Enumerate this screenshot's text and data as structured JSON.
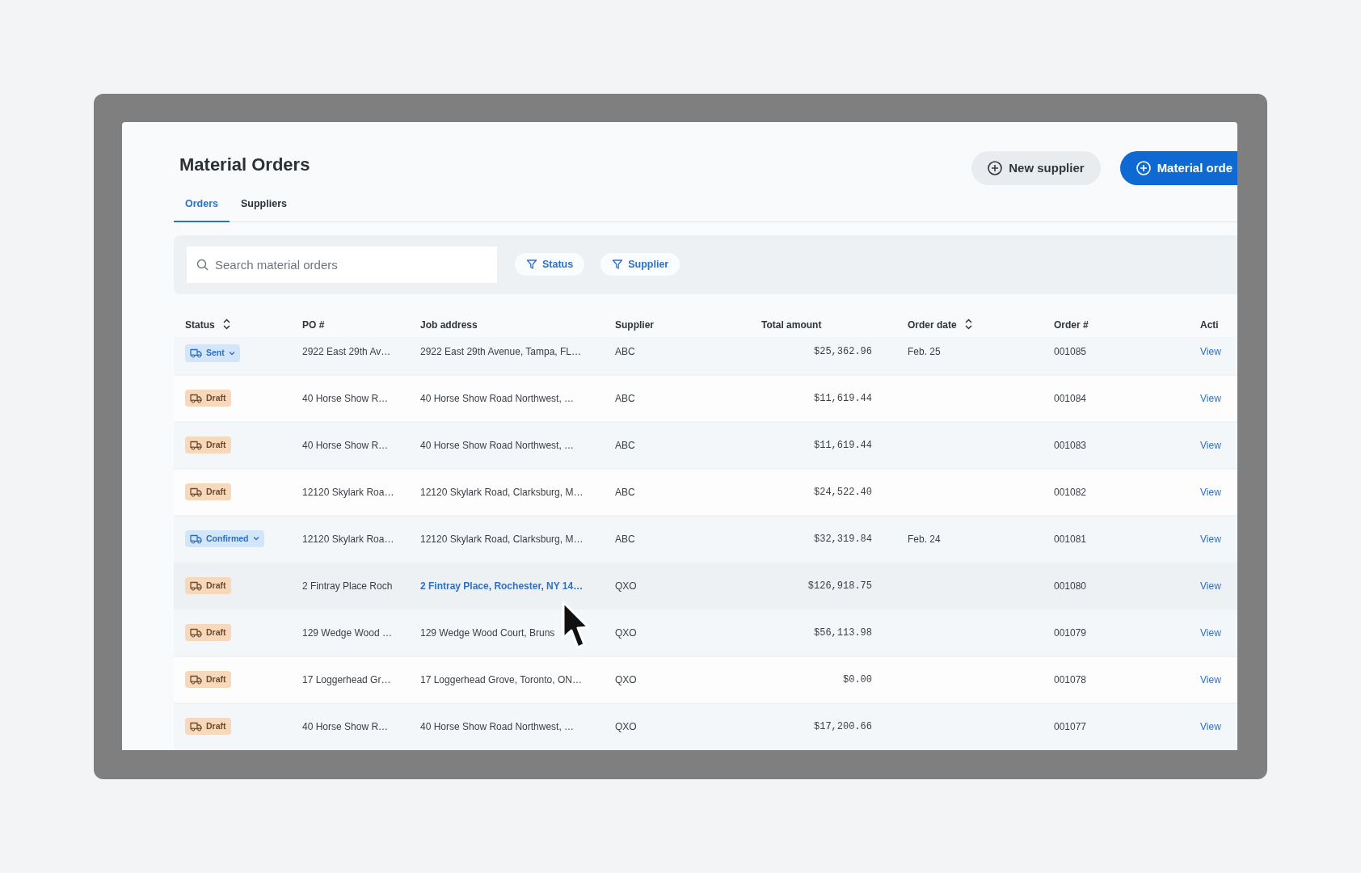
{
  "title": "Material Orders",
  "header_buttons": [
    {
      "label": "New supplier",
      "kind": "secondary"
    },
    {
      "label": "Material orde",
      "kind": "primary"
    }
  ],
  "tabs": [
    {
      "label": "Orders",
      "selected": true
    },
    {
      "label": "Suppliers",
      "selected": false
    }
  ],
  "search": {
    "placeholder": "Search material orders"
  },
  "filters": [
    {
      "label": "Status"
    },
    {
      "label": "Supplier"
    }
  ],
  "table": {
    "columns": [
      {
        "label": "Status",
        "sortable": true
      },
      {
        "label": "PO #",
        "sortable": false
      },
      {
        "label": "Job address",
        "sortable": false
      },
      {
        "label": "Supplier",
        "sortable": false
      },
      {
        "label": "Total amount",
        "sortable": false
      },
      {
        "label": "Order date",
        "sortable": true
      },
      {
        "label": "Order #",
        "sortable": false
      },
      {
        "label": "Acti",
        "sortable": false
      }
    ],
    "rows": [
      {
        "status": {
          "label": "Sent",
          "kind": "sent",
          "dropdown": true
        },
        "po": "2922 East 29th Av…",
        "job_address": "2922 East 29th Avenue, Tampa, FL…",
        "supplier": "ABC",
        "total": "$25,362.96",
        "order_date": "Feb. 25",
        "order_no": "001085",
        "action": "View",
        "hovered": false
      },
      {
        "status": {
          "label": "Draft",
          "kind": "draft",
          "dropdown": false
        },
        "po": "40 Horse Show R…",
        "job_address": "40 Horse Show Road Northwest, …",
        "supplier": "ABC",
        "total": "$11,619.44",
        "order_no": "001084",
        "action": "View",
        "hovered": false
      },
      {
        "status": {
          "label": "Draft",
          "kind": "draft",
          "dropdown": false
        },
        "po": "40 Horse Show R…",
        "job_address": "40 Horse Show Road Northwest, …",
        "supplier": "ABC",
        "total": "$11,619.44",
        "order_no": "001083",
        "action": "View",
        "hovered": false
      },
      {
        "status": {
          "label": "Draft",
          "kind": "draft",
          "dropdown": false
        },
        "po": "12120 Skylark Roa…",
        "job_address": "12120 Skylark Road, Clarksburg, M…",
        "supplier": "ABC",
        "total": "$24,522.40",
        "order_no": "001082",
        "action": "View",
        "hovered": false
      },
      {
        "status": {
          "label": "Confirmed",
          "kind": "sent",
          "dropdown": true
        },
        "po": "12120 Skylark Roa…",
        "job_address": "12120 Skylark Road, Clarksburg, M…",
        "supplier": "ABC",
        "total": "$32,319.84",
        "order_date": "Feb. 24",
        "order_no": "001081",
        "action": "View",
        "hovered": false
      },
      {
        "status": {
          "label": "Draft",
          "kind": "draft",
          "dropdown": false
        },
        "po": "2 Fintray Place Roch",
        "job_address": "2 Fintray Place, Rochester, NY 14…",
        "supplier": "QXO",
        "total": "$126,918.75",
        "order_no": "001080",
        "action": "View",
        "hovered": true
      },
      {
        "status": {
          "label": "Draft",
          "kind": "draft",
          "dropdown": false
        },
        "po": "129 Wedge Wood …",
        "job_address": "129 Wedge Wood Court, Bruns",
        "supplier": "QXO",
        "total": "$56,113.98",
        "order_no": "001079",
        "action": "View",
        "hovered": false
      },
      {
        "status": {
          "label": "Draft",
          "kind": "draft",
          "dropdown": false
        },
        "po": "17 Loggerhead Gr…",
        "job_address": "17 Loggerhead Grove, Toronto, ON…",
        "supplier": "QXO",
        "total": "$0.00",
        "order_no": "001078",
        "action": "View",
        "hovered": false
      },
      {
        "status": {
          "label": "Draft",
          "kind": "draft",
          "dropdown": false
        },
        "po": "40 Horse Show R…",
        "job_address": "40 Horse Show Road Northwest, …",
        "supplier": "QXO",
        "total": "$17,200.66",
        "order_no": "001077",
        "action": "View",
        "hovered": false
      }
    ]
  }
}
